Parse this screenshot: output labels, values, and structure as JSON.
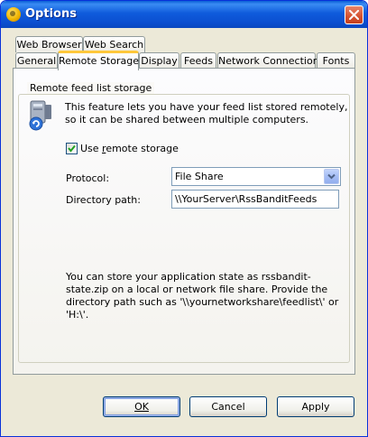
{
  "window": {
    "title": "Options"
  },
  "tabs_back": [
    "Web Browser",
    "Web Search"
  ],
  "tabs_front": [
    "General",
    "Remote Storage",
    "Display",
    "Feeds",
    "Network Connection",
    "Fonts"
  ],
  "group": {
    "title": "Remote feed list storage",
    "info": "This feature lets you have your feed list stored remotely, so it can be shared between multiple computers."
  },
  "use_remote": {
    "label_pre": "Use ",
    "label_u": "r",
    "label_post": "emote storage",
    "checked": true
  },
  "protocol": {
    "label": "Protocol:",
    "value": "File Share"
  },
  "directory": {
    "label": "Directory path:",
    "value": "\\\\YourServer\\RssBanditFeeds"
  },
  "note": "You can store your application state as rssbandit-state.zip on a local or network file share. Provide the directory path such as '\\\\yournetworkshare\\feedlist\\' or 'H:\\'.",
  "buttons": {
    "ok": "OK",
    "cancel": "Cancel",
    "apply": "Apply"
  },
  "icons": {
    "app": "rss-bandit-icon",
    "close": "close-icon",
    "info": "remote-computer-icon",
    "dropdown": "chevron-down-icon",
    "check": "checkmark-icon"
  },
  "colors": {
    "titlebar": "#0a5fd6",
    "face": "#ece9d8",
    "tab_highlight": "#ffc83c"
  }
}
